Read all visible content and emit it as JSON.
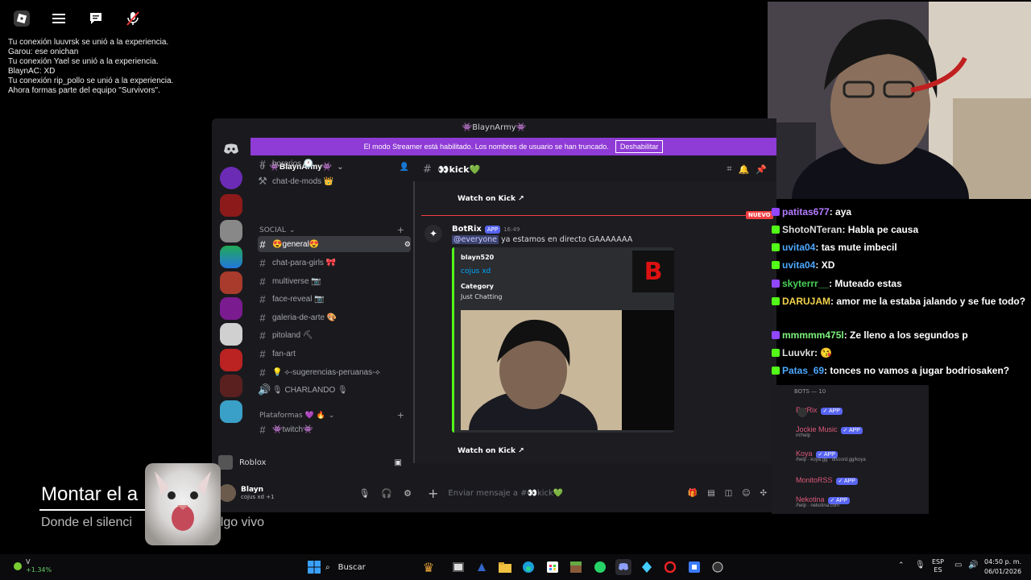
{
  "roblox": {
    "chat": [
      "Tu conexión luuvrsk se unió a la experiencia.",
      "Garou: ese onichan",
      "Tu conexión Yael se unió a la experiencia.",
      "BlaynAC: XD",
      "Tu conexión rip_pollo se unió a la experiencia.",
      "Ahora formas parte del equipo \"Survivors\"."
    ]
  },
  "discord": {
    "window_title": "👾BlaynArmy👾",
    "banner_text": "El modo Streamer está habilitado. Los nombres de usuario se han truncado.",
    "banner_button": "Deshabilitar",
    "server_name": "👾BlaynArmy👾",
    "server_count": "0",
    "channels_top": [
      {
        "name": "horarios 🕐"
      },
      {
        "name": "chat-de-mods 👑"
      }
    ],
    "category_social": "SOCIAL",
    "channels_social": [
      {
        "name": "😍general😍",
        "active": true
      },
      {
        "name": "chat-para-girls 🎀"
      },
      {
        "name": "multiverse 📷"
      },
      {
        "name": "face-reveal 📷"
      },
      {
        "name": "galeria-de-arte 🎨"
      },
      {
        "name": "pitoland ⛏"
      },
      {
        "name": "fan-art"
      },
      {
        "name": "💡 ⟡-sugerencias-peruanas-⟡"
      },
      {
        "name": "🎙 CHARLANDO 🎙",
        "voice": true
      }
    ],
    "category_platforms": "Plataformas 💜 🔥",
    "channels_platforms": [
      {
        "name": "👾twitch👾"
      }
    ],
    "voice_connected": "Roblox",
    "user": {
      "name": "Blayn",
      "status": "cojus xd +1"
    },
    "current_channel": "👀kick💚",
    "messages": {
      "watch_on_kick_1": "Watch on Kick",
      "new_label": "NUEVO",
      "author": "BotRix",
      "app_tag": "APP",
      "time": "16:49",
      "mention": "@everyone",
      "text": "ya estamos en directo GAAAAAAA",
      "embed": {
        "author": "blayn520",
        "title": "cojus xd",
        "field_name": "Category",
        "field_value": "Just Chatting"
      },
      "watch_on_kick_2": "Watch on Kick"
    },
    "input_placeholder": "Enviar mensaje a #👀kick💚",
    "bots_header": "BOTS — 10",
    "bots": [
      {
        "name": "BotRix",
        "sub": ""
      },
      {
        "name": "Jockie Music",
        "sub": "m!help"
      },
      {
        "name": "Koya",
        "sub": "/help · koya.gg · discord.gg/koya"
      },
      {
        "name": "MonitoRSS",
        "sub": ""
      },
      {
        "name": "Nekotina",
        "sub": "/help · nekotina.com"
      }
    ]
  },
  "overlay_chat": [
    {
      "user": "patitas677",
      "msg": ": aya",
      "color": "#b57cff"
    },
    {
      "user": "ShotoNTeran",
      "msg": ": Habla pe causa",
      "color": "#ffffff"
    },
    {
      "user": "uvita04",
      "msg": ": tas mute imbecil",
      "color": "#4da8ff"
    },
    {
      "user": "uvita04",
      "msg": ": XD",
      "color": "#4da8ff"
    },
    {
      "user": "skyterrr__",
      "msg": ": Muteado estas",
      "color": "#4ad15a"
    },
    {
      "user": "DARUJAM",
      "msg": ": amor me la estaba jalando y se fue todo?",
      "color": "#f2d24b"
    },
    {
      "user": "mmmmm475l",
      "msg": ": Ze lleno a los segundos p",
      "color": "#7df27d"
    },
    {
      "user": "Luuvkr",
      "msg": ": 😘",
      "color": "#ffffff"
    },
    {
      "user": "Patas_69",
      "msg": ": tonces no vamos a jugar bodriosaken?",
      "color": "#4da8ff"
    }
  ],
  "stream_overlay": {
    "title": "Montar el a",
    "subtitle_left": "Donde el silenci",
    "subtitle_right": "algo vivo"
  },
  "taskbar": {
    "stock_label": "V",
    "stock_change": "+1.34%",
    "search_label": "Buscar",
    "lang_1": "ESP",
    "lang_2": "ES",
    "time": "04:50 p. m.",
    "date": "06/01/2026"
  }
}
